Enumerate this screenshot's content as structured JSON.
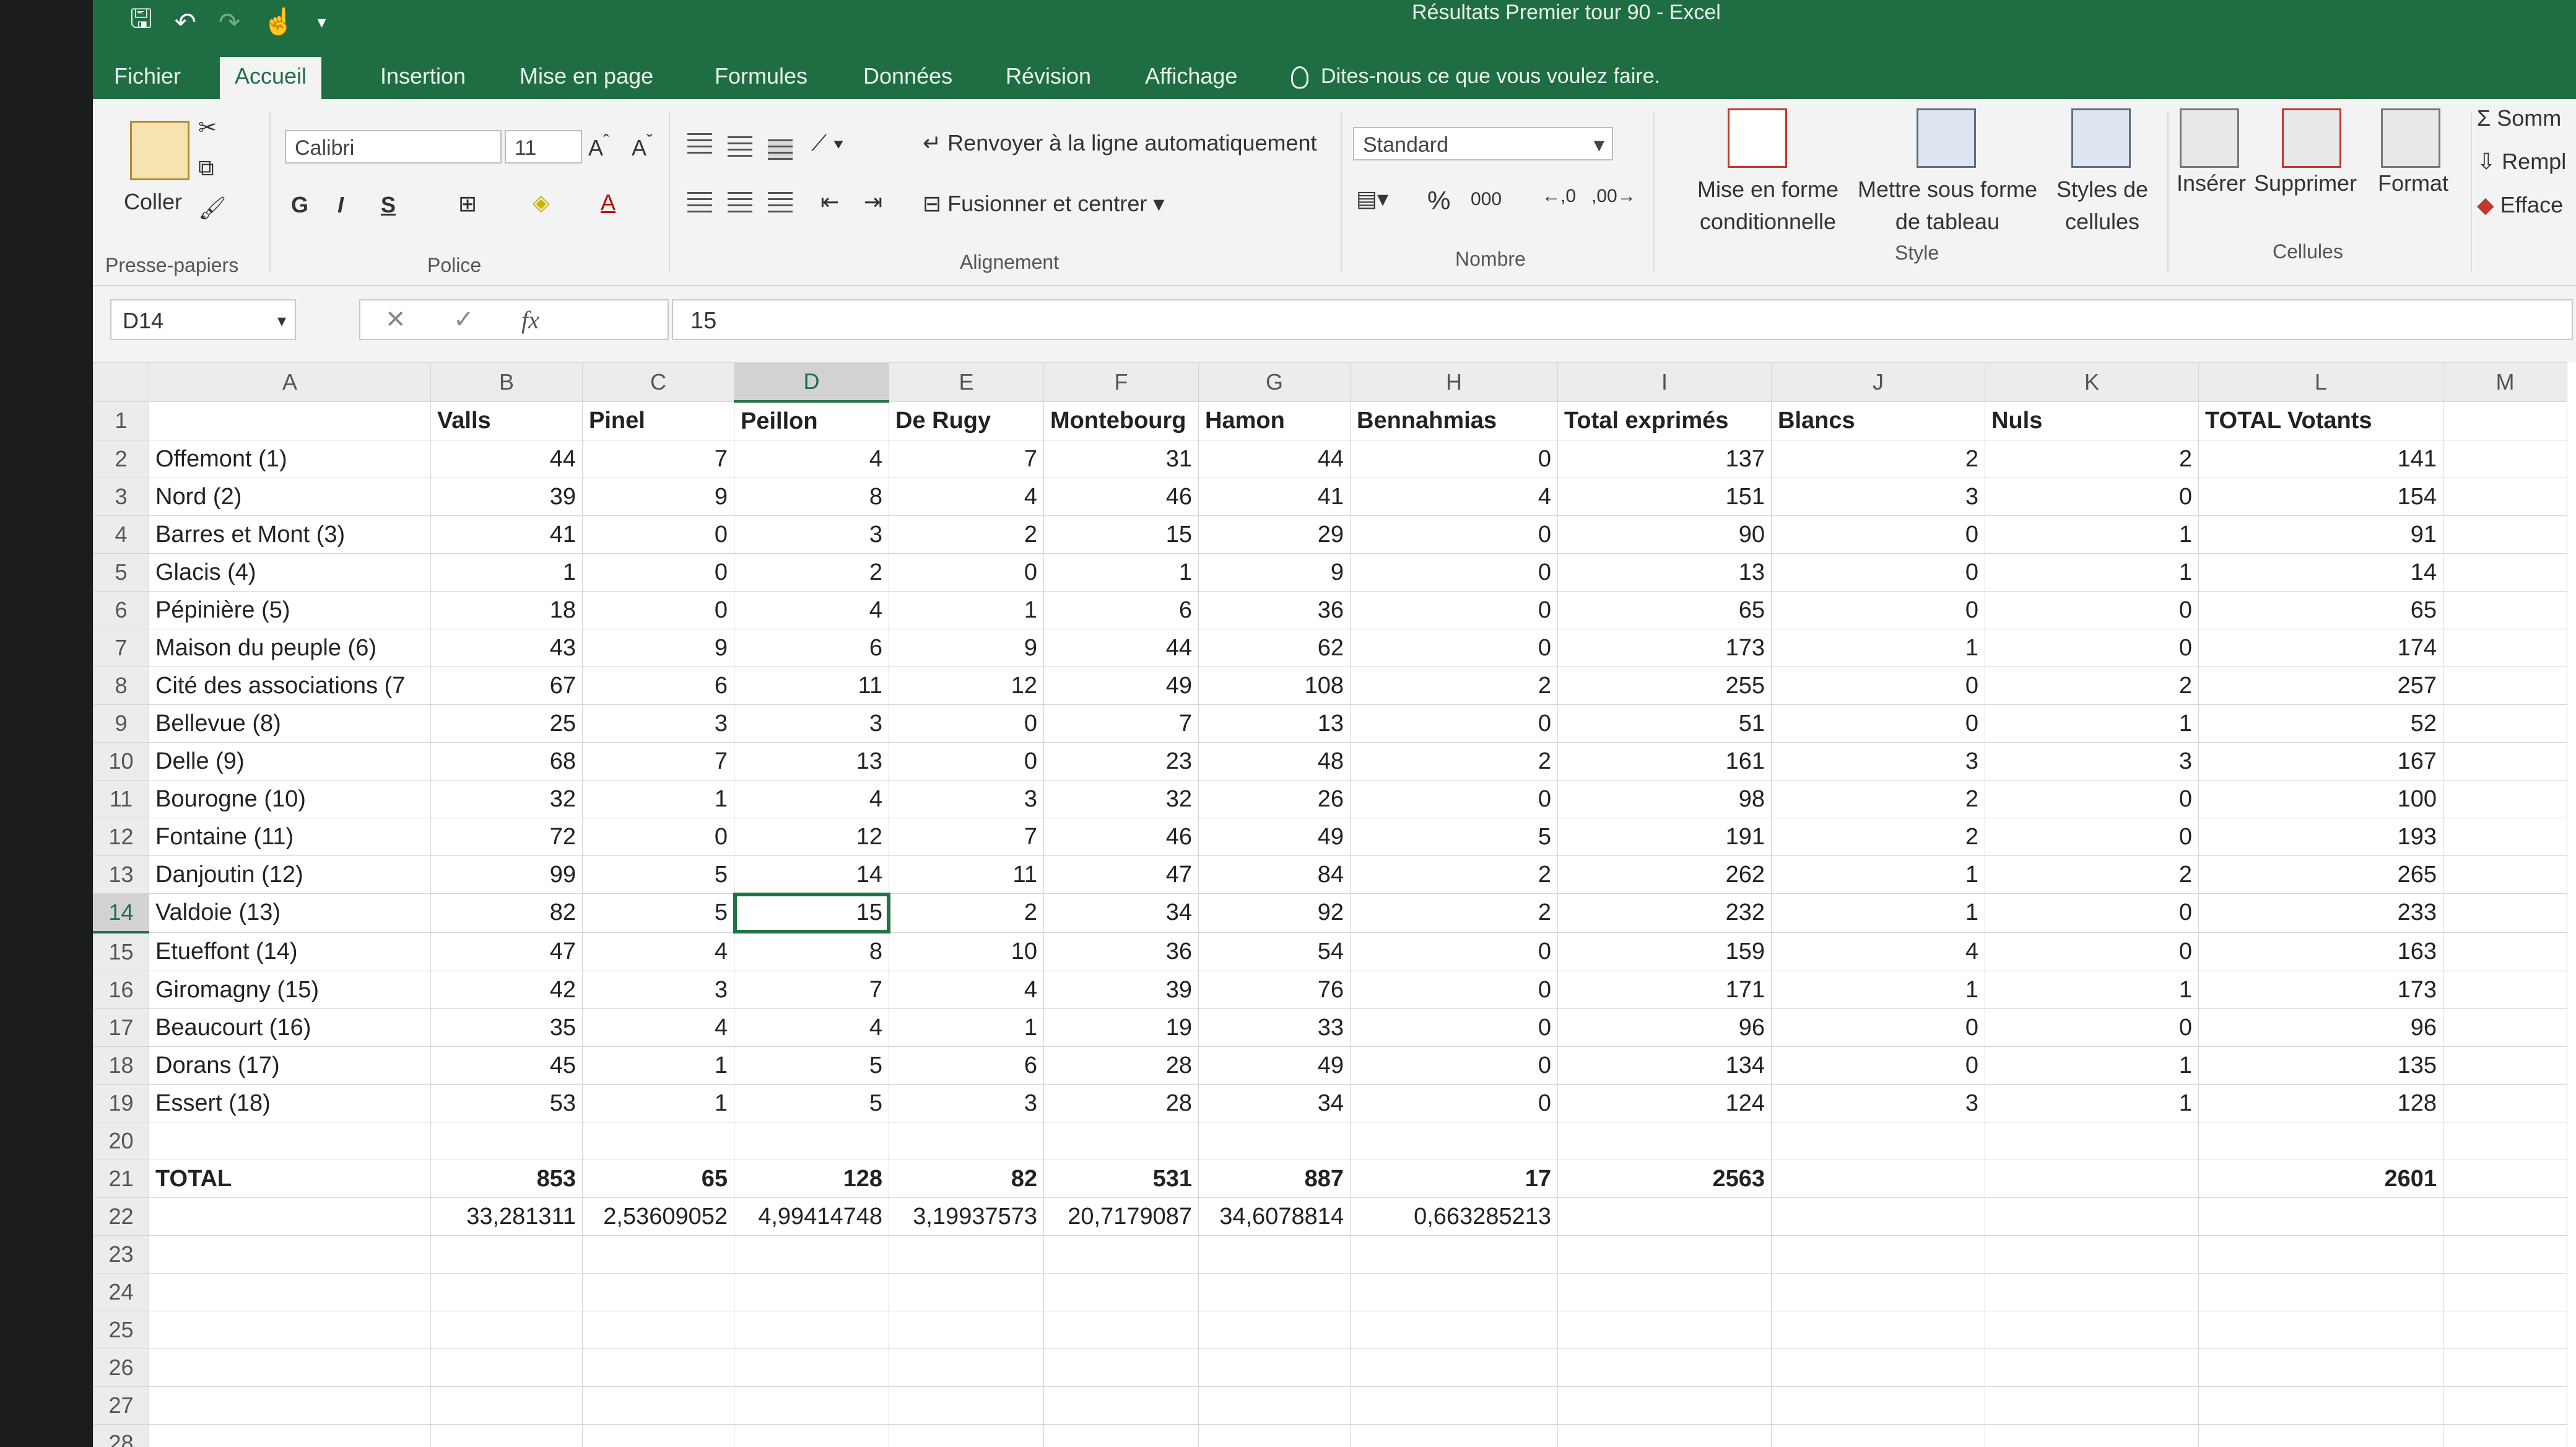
{
  "app": {
    "title": "Résultats Premier tour 90 - Excel",
    "accent": "#1f6e43"
  },
  "ribbon_tabs": [
    "Fichier",
    "Accueil",
    "Insertion",
    "Mise en page",
    "Formules",
    "Données",
    "Révision",
    "Affichage"
  ],
  "tell_me": "Dites-nous ce que vous voulez faire.",
  "ribbon": {
    "clipboard": {
      "paste": "Coller",
      "label": "Presse-papiers"
    },
    "font": {
      "name": "Calibri",
      "size": "11",
      "bold": "G",
      "italic": "I",
      "underline": "S",
      "label": "Police"
    },
    "alignment": {
      "wrap": "Renvoyer à la ligne automatiquement",
      "merge": "Fusionner et centrer",
      "label": "Alignement"
    },
    "number": {
      "format": "Standard",
      "percent": "%",
      "thousands": "000",
      "label": "Nombre"
    },
    "style": {
      "conditional": "Mise en forme conditionnelle",
      "table": "Mettre sous forme de tableau",
      "cell_styles": "Styles de cellules",
      "label": "Style"
    },
    "cells": {
      "insert": "Insérer",
      "delete": "Supprimer",
      "format": "Format",
      "label": "Cellules"
    },
    "editing": {
      "sum": "Somm",
      "fill": "Rempl",
      "clear": "Efface"
    }
  },
  "formula_bar": {
    "name_box": "D14",
    "fx": "fx",
    "value": "15"
  },
  "columns": [
    "A",
    "B",
    "C",
    "D",
    "E",
    "F",
    "G",
    "H",
    "I",
    "J",
    "K",
    "L",
    "M"
  ],
  "header_row": [
    "",
    "Valls",
    "Pinel",
    "Peillon",
    "De Rugy",
    "Montebourg",
    "Hamon",
    "Bennahmias",
    "Total exprimés",
    "Blancs",
    "Nuls",
    "TOTAL Votants",
    ""
  ],
  "rows": [
    [
      "Offemont (1)",
      "44",
      "7",
      "4",
      "7",
      "31",
      "44",
      "0",
      "137",
      "2",
      "2",
      "141"
    ],
    [
      "Nord (2)",
      "39",
      "9",
      "8",
      "4",
      "46",
      "41",
      "4",
      "151",
      "3",
      "0",
      "154"
    ],
    [
      "Barres et Mont (3)",
      "41",
      "0",
      "3",
      "2",
      "15",
      "29",
      "0",
      "90",
      "0",
      "1",
      "91"
    ],
    [
      "Glacis (4)",
      "1",
      "0",
      "2",
      "0",
      "1",
      "9",
      "0",
      "13",
      "0",
      "1",
      "14"
    ],
    [
      "Pépinière (5)",
      "18",
      "0",
      "4",
      "1",
      "6",
      "36",
      "0",
      "65",
      "0",
      "0",
      "65"
    ],
    [
      "Maison du peuple (6)",
      "43",
      "9",
      "6",
      "9",
      "44",
      "62",
      "0",
      "173",
      "1",
      "0",
      "174"
    ],
    [
      "Cité des associations (7",
      "67",
      "6",
      "11",
      "12",
      "49",
      "108",
      "2",
      "255",
      "0",
      "2",
      "257"
    ],
    [
      "Bellevue (8)",
      "25",
      "3",
      "3",
      "0",
      "7",
      "13",
      "0",
      "51",
      "0",
      "1",
      "52"
    ],
    [
      "Delle (9)",
      "68",
      "7",
      "13",
      "0",
      "23",
      "48",
      "2",
      "161",
      "3",
      "3",
      "167"
    ],
    [
      "Bourogne (10)",
      "32",
      "1",
      "4",
      "3",
      "32",
      "26",
      "0",
      "98",
      "2",
      "0",
      "100"
    ],
    [
      "Fontaine (11)",
      "72",
      "0",
      "12",
      "7",
      "46",
      "49",
      "5",
      "191",
      "2",
      "0",
      "193"
    ],
    [
      "Danjoutin (12)",
      "99",
      "5",
      "14",
      "11",
      "47",
      "84",
      "2",
      "262",
      "1",
      "2",
      "265"
    ],
    [
      "Valdoie (13)",
      "82",
      "5",
      "15",
      "2",
      "34",
      "92",
      "2",
      "232",
      "1",
      "0",
      "233"
    ],
    [
      "Etueffont (14)",
      "47",
      "4",
      "8",
      "10",
      "36",
      "54",
      "0",
      "159",
      "4",
      "0",
      "163"
    ],
    [
      "Giromagny (15)",
      "42",
      "3",
      "7",
      "4",
      "39",
      "76",
      "0",
      "171",
      "1",
      "1",
      "173"
    ],
    [
      "Beaucourt (16)",
      "35",
      "4",
      "4",
      "1",
      "19",
      "33",
      "0",
      "96",
      "0",
      "0",
      "96"
    ],
    [
      "Dorans (17)",
      "45",
      "1",
      "5",
      "6",
      "28",
      "49",
      "0",
      "134",
      "0",
      "1",
      "135"
    ],
    [
      "Essert (18)",
      "53",
      "1",
      "5",
      "3",
      "28",
      "34",
      "0",
      "124",
      "3",
      "1",
      "128"
    ]
  ],
  "total_row": [
    "TOTAL",
    "853",
    "65",
    "128",
    "82",
    "531",
    "887",
    "17",
    "2563",
    "",
    "",
    "2601"
  ],
  "percent_row": [
    "",
    "33,281311",
    "2,53609052",
    "4,99414748",
    "3,19937573",
    "20,7179087",
    "34,6078814",
    "0,663285213",
    "",
    "",
    "",
    ""
  ],
  "empty_row_numbers": [
    "20",
    "23",
    "24",
    "25",
    "26",
    "27",
    "28"
  ]
}
